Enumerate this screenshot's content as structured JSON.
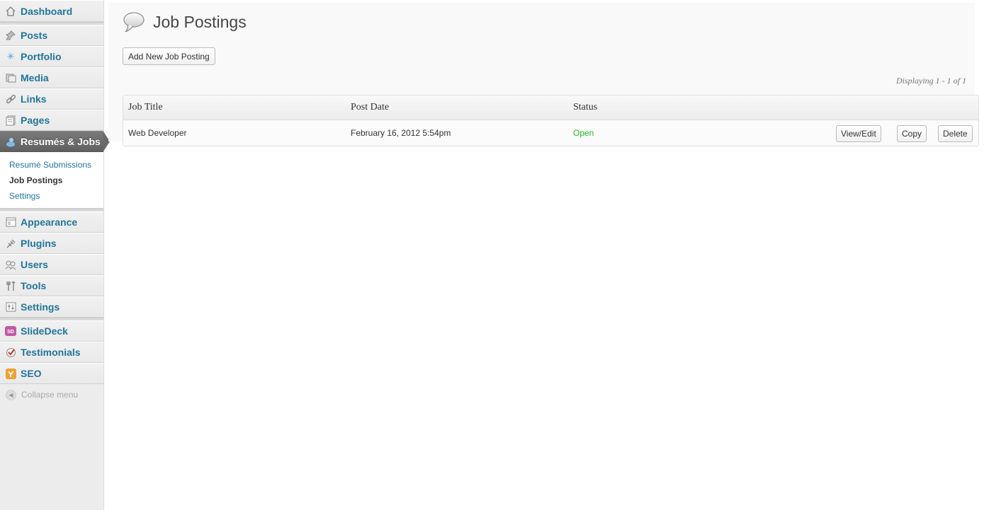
{
  "sidebar": {
    "items_top": [
      {
        "label": "Dashboard",
        "icon": "dashboard-icon"
      }
    ],
    "items_group1": [
      {
        "label": "Posts",
        "icon": "pushpin-icon"
      },
      {
        "label": "Portfolio",
        "icon": "portfolio-icon"
      },
      {
        "label": "Media",
        "icon": "media-icon"
      },
      {
        "label": "Links",
        "icon": "link-icon"
      },
      {
        "label": "Pages",
        "icon": "pages-icon"
      },
      {
        "label": "Resumés & Jobs",
        "icon": "resumes-icon"
      }
    ],
    "submenu": [
      {
        "label": "Resumé Submissions"
      },
      {
        "label": "Job Postings"
      },
      {
        "label": "Settings"
      }
    ],
    "items_group2": [
      {
        "label": "Appearance",
        "icon": "appearance-icon"
      },
      {
        "label": "Plugins",
        "icon": "plug-icon"
      },
      {
        "label": "Users",
        "icon": "users-icon"
      },
      {
        "label": "Tools",
        "icon": "tools-icon"
      },
      {
        "label": "Settings",
        "icon": "settings-icon"
      }
    ],
    "items_group3": [
      {
        "label": "SlideDeck",
        "icon": "slidedeck-icon"
      },
      {
        "label": "Testimonials",
        "icon": "testimonials-icon"
      },
      {
        "label": "SEO",
        "icon": "seo-icon"
      }
    ],
    "collapse_label": "Collapse menu"
  },
  "page": {
    "title": "Job Postings",
    "add_button": "Add New Job Posting",
    "displaying": "Displaying 1 - 1 of 1"
  },
  "table": {
    "headers": [
      "Job Title",
      "Post Date",
      "Status"
    ],
    "rows": [
      {
        "title": "Web Developer",
        "date": "February 16, 2012 5:54pm",
        "status": "Open",
        "actions": [
          "View/Edit",
          "Copy",
          "Delete"
        ]
      }
    ]
  },
  "colors": {
    "link": "#21759b",
    "status_open": "#22bb22",
    "active_menu": "#6a6a6a"
  }
}
